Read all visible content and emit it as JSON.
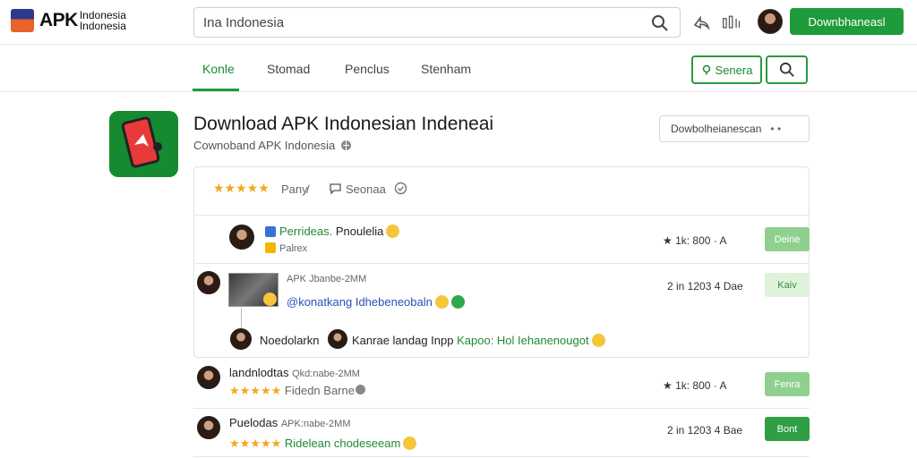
{
  "brand": {
    "name": "APK",
    "sub_line1": "Indonesia",
    "sub_line2": "Indonesia"
  },
  "search": {
    "value": "Ina Indonesia",
    "placeholder": ""
  },
  "header": {
    "download_button": "Downbhaneasl"
  },
  "nav": {
    "tabs": [
      {
        "label": "Konle",
        "active": true
      },
      {
        "label": "Stomad",
        "active": false
      },
      {
        "label": "Penclus",
        "active": false
      },
      {
        "label": "Stenham",
        "active": false
      }
    ],
    "green_button": "Senera"
  },
  "app": {
    "title": "Download APK Indonesian Indeneai",
    "subtitle": "Cownoband APK Indonesia",
    "dropdown_label": "Dowbolheianescan",
    "dropdown_arrows": "• •"
  },
  "card": {
    "stars": "★★★★★",
    "rating_text": "Pany",
    "separator": "/",
    "comment_label": "Seonaa"
  },
  "reviews": [
    {
      "name": "Perrideas.",
      "name_extra": "Pnoulelia",
      "sub": "Palrex",
      "stat": "★ 1k: 800 · A",
      "action": "Deine"
    },
    {
      "meta": "APK Jbanbe-2MM",
      "mention": "@konatkang",
      "body": "Idhebeneobaln",
      "stat": "2 in 1203 4 Dae",
      "action": "Kaiv",
      "reply_name": "Noedolarkn",
      "reply_text1": "Kanrae landag Inpp",
      "reply_text2": "Kapoo: Hol Iehanenougot"
    },
    {
      "name": "landnlodtas",
      "meta": "Qkd:nabe-2MM",
      "stars": "★★★★★",
      "text": "Fidedn Barne",
      "stat": "★ 1k: 800 · A",
      "action": "Fenra"
    },
    {
      "name": "Puelodas",
      "meta": "APK:nabe-2MM",
      "stars": "★★★★★",
      "text": "Ridelean chodeseeam",
      "stat": "2 in 1203 4 Bae",
      "action": "Bont"
    }
  ],
  "colors": {
    "accent": "#1e9b3a",
    "star": "#f0a81c",
    "link": "#2b4fb8"
  }
}
